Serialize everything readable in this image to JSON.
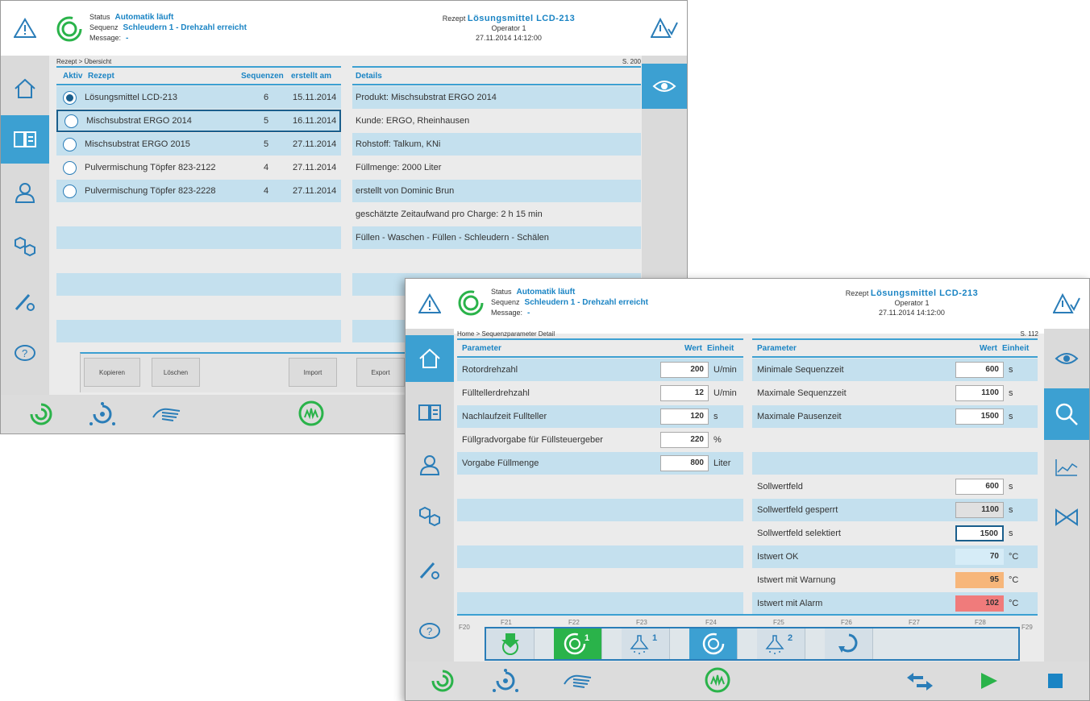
{
  "w1": {
    "status": {
      "status_label": "Status",
      "status_value": "Automatik läuft",
      "sequence_label": "Sequenz",
      "sequence_value": "Schleudern 1 - Drehzahl erreicht",
      "message_label": "Message:",
      "message_value": "-"
    },
    "recipe": {
      "label": "Rezept",
      "name": "Lösungsmittel LCD-213",
      "operator": "Operator 1",
      "datetime": "27.11.2014  14:12:00"
    },
    "breadcrumb": "Rezept > Übersicht",
    "page": "S. 200",
    "table": {
      "headers": {
        "aktiv": "Aktiv",
        "rezept": "Rezept",
        "sequenzen": "Sequenzen",
        "erstellt": "erstellt am"
      },
      "rows": [
        {
          "name": "Lösungsmittel LCD-213",
          "seq": "6",
          "date": "15.11.2014"
        },
        {
          "name": "Mischsubstrat ERGO 2014",
          "seq": "5",
          "date": "16.11.2014"
        },
        {
          "name": "Mischsubstrat ERGO 2015",
          "seq": "5",
          "date": "27.11.2014"
        },
        {
          "name": "Pulvermischung Töpfer 823-2122",
          "seq": "4",
          "date": "27.11.2014"
        },
        {
          "name": "Pulvermischung Töpfer 823-2228",
          "seq": "4",
          "date": "27.11.2014"
        }
      ]
    },
    "details": {
      "header": "Details",
      "lines": [
        "Produkt: Mischsubstrat ERGO 2014",
        "Kunde:  ERGO, Rheinhausen",
        "Rohstoff:  Talkum, KNi",
        "Füllmenge: 2000 Liter",
        "erstellt von Dominic Brun",
        "geschätzte Zeitaufwand pro Charge: 2 h 15 min",
        "Füllen - Waschen - Füllen - Schleudern - Schälen"
      ]
    },
    "buttons": {
      "kopieren": "Kopieren",
      "loeschen": "Löschen",
      "import": "Import",
      "export": "Export"
    }
  },
  "w2": {
    "status": {
      "status_label": "Status",
      "status_value": "Automatik läuft",
      "sequence_label": "Sequenz",
      "sequence_value": "Schleudern 1 - Drehzahl erreicht",
      "message_label": "Message:",
      "message_value": "-"
    },
    "recipe": {
      "label": "Rezept",
      "name": "Lösungsmittel LCD-213",
      "operator": "Operator 1",
      "datetime": "27.11.2014  14:12:00"
    },
    "breadcrumb": "Home > Sequenzparameter Detail",
    "page": "S. 112",
    "left": {
      "headers": {
        "param": "Parameter",
        "wert": "Wert",
        "einheit": "Einheit"
      },
      "rows": [
        {
          "label": "Rotordrehzahl",
          "value": "200",
          "unit": "U/min"
        },
        {
          "label": "Fülltellerdrehzahl",
          "value": "12",
          "unit": "U/min"
        },
        {
          "label": "Nachlaufzeit Fullteller",
          "value": "120",
          "unit": "s"
        },
        {
          "label": "Füllgradvorgabe für Füllsteuergeber",
          "value": "220",
          "unit": "%"
        },
        {
          "label": "Vorgabe Füllmenge",
          "value": "800",
          "unit": "Liter"
        }
      ]
    },
    "right": {
      "headers": {
        "param": "Parameter",
        "wert": "Wert",
        "einheit": "Einheit"
      },
      "rows": [
        {
          "label": "Minimale Sequenzzeit",
          "value": "600",
          "unit": "s"
        },
        {
          "label": "Maximale Sequenzzeit",
          "value": "1100",
          "unit": "s"
        },
        {
          "label": "Maximale Pausenzeit",
          "value": "1500",
          "unit": "s"
        },
        {
          "label": "Sollwertfeld",
          "value": "600",
          "unit": "s"
        },
        {
          "label": "Sollwertfeld gesperrt",
          "value": "1100",
          "unit": "s"
        },
        {
          "label": "Sollwertfeld selektiert",
          "value": "1500",
          "unit": "s"
        },
        {
          "label": "Istwert OK",
          "value": "70",
          "unit": "°C"
        },
        {
          "label": "Istwert mit Warnung",
          "value": "95",
          "unit": "°C"
        },
        {
          "label": "Istwert mit Alarm",
          "value": "102",
          "unit": "°C"
        }
      ]
    },
    "fkeys": [
      "F20",
      "F21",
      "F22",
      "F23",
      "F24",
      "F25",
      "F26",
      "F27",
      "F28",
      "F29"
    ],
    "fbadges": {
      "f22": "1",
      "f23": "1",
      "f25": "2"
    }
  },
  "colors": {
    "accent": "#3ca0d2",
    "title_blue": "#1a84c4",
    "green": "#2ab34a",
    "warn": "#f7b67a",
    "alarm": "#f07b7b"
  }
}
